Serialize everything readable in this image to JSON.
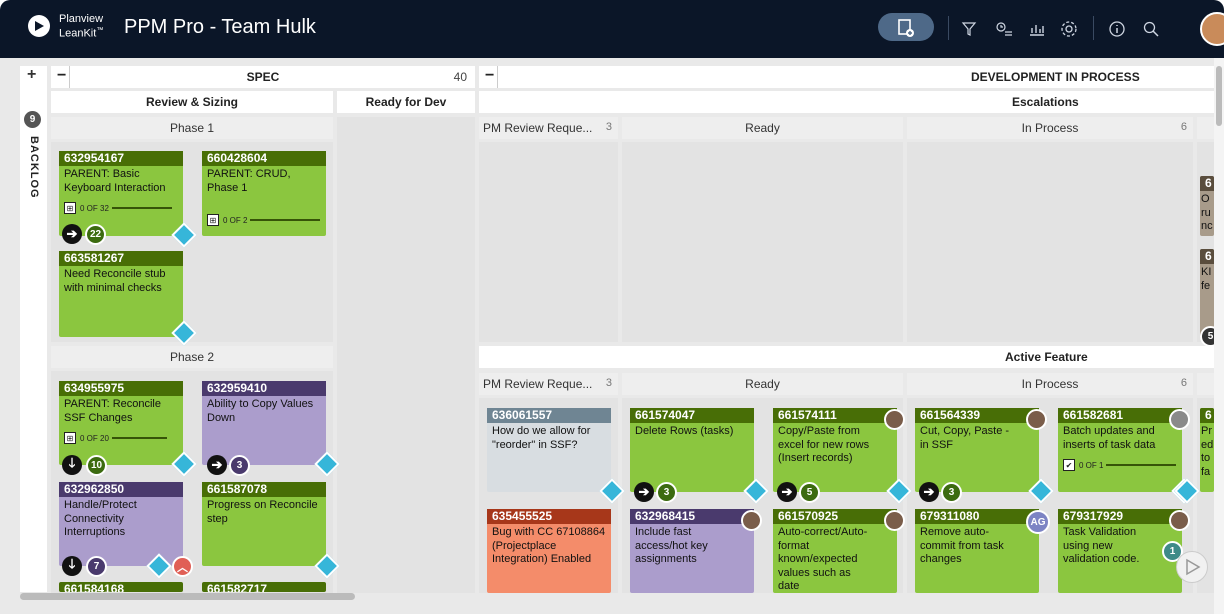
{
  "app": {
    "brand_line1": "Planview",
    "brand_line2": "LeanKit",
    "brand_tm": "™",
    "title": "PPM Pro - Team Hulk"
  },
  "toolbar": {
    "icons": [
      "add-card-icon",
      "filter-icon",
      "timer-list-icon",
      "analytics-icon",
      "settings-icon",
      "info-icon",
      "search-icon",
      "user-avatar"
    ]
  },
  "backlog": {
    "label": "BACKLOG",
    "count": "9",
    "expand": "+"
  },
  "spec": {
    "title": "SPEC",
    "count": "40",
    "collapse": "−",
    "review_sizing": "Review & Sizing",
    "ready_for_dev": "Ready for Dev",
    "phase1": "Phase 1",
    "phase2": "Phase 2"
  },
  "dev": {
    "title": "DEVELOPMENT IN PROCESS",
    "collapse": "−",
    "escalations": "Escalations",
    "active_feature": "Active Feature",
    "esc_cols": [
      {
        "label": "PM Review Reque...",
        "count": "3"
      },
      {
        "label": "Ready",
        "count": ""
      },
      {
        "label": "In Process",
        "count": "6"
      }
    ],
    "af_cols": [
      {
        "label": "PM Review Reque...",
        "count": "3"
      },
      {
        "label": "Ready",
        "count": ""
      },
      {
        "label": "In Process",
        "count": "6"
      }
    ]
  },
  "cards": {
    "c1": {
      "id": "632954167",
      "text": "PARENT: Basic Keyboard Interaction",
      "prog": "0 OF 32",
      "badge": "22"
    },
    "c2": {
      "id": "660428604",
      "text": "PARENT: CRUD, Phase 1",
      "prog": "0 OF 2"
    },
    "c3": {
      "id": "663581267",
      "text": "Need Reconcile stub with minimal checks"
    },
    "c4": {
      "id": "634955975",
      "text": "PARENT: Reconcile SSF Changes",
      "prog": "0 OF 20",
      "badge": "10"
    },
    "c5": {
      "id": "632959410",
      "text": "Ability to Copy Values Down",
      "badge": "3"
    },
    "c6": {
      "id": "632962850",
      "text": "Handle/Protect Connectivity Interruptions",
      "badge": "7"
    },
    "c7": {
      "id": "661587078",
      "text": "Progress on Reconcile step"
    },
    "c8": {
      "id": "661584168",
      "text": ""
    },
    "c9": {
      "id": "661582717",
      "text": ""
    },
    "c10": {
      "id": "636061557",
      "text": "How do we allow for \"reorder\" in SSF?"
    },
    "c11": {
      "id": "635455525",
      "text": "Bug with CC 67108864 (Projectplace Integration) Enabled"
    },
    "c12": {
      "id": "661574047",
      "text": "Delete Rows (tasks)",
      "badge": "3"
    },
    "c13": {
      "id": "661574111",
      "text": "Copy/Paste from excel for new rows (Insert records)",
      "badge": "5"
    },
    "c14": {
      "id": "632968415",
      "text": "Include fast access/hot key assignments"
    },
    "c15": {
      "id": "661570925",
      "text": "Auto-correct/Auto-format known/expected values such as date"
    },
    "c16": {
      "id": "661564339",
      "text": "Cut, Copy, Paste - in SSF",
      "badge": "3"
    },
    "c17": {
      "id": "661582681",
      "text": "Batch updates and inserts of task data",
      "prog": "0 OF 1"
    },
    "c18": {
      "id": "679311080",
      "text": "Remove auto-commit from task changes",
      "avatar": "AG"
    },
    "c19": {
      "id": "679317929",
      "text": "Task Validation using new validation code.",
      "badge": "1"
    },
    "e1": {
      "id": "6",
      "text": "O ru nc ov"
    },
    "e2": {
      "id": "6",
      "text": "KI fe",
      "badge": "5"
    },
    "a1": {
      "id": "6",
      "text": "Pr ed to fa"
    }
  }
}
